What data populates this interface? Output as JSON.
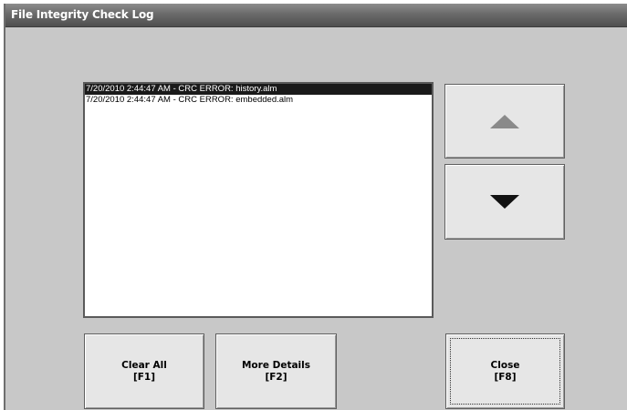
{
  "window": {
    "title": "File Integrity Check Log"
  },
  "log": {
    "entries": [
      {
        "text": "7/20/2010 2:44:47 AM - CRC ERROR: history.alm",
        "selected": true
      },
      {
        "text": "7/20/2010 2:44:47 AM - CRC ERROR: embedded.alm",
        "selected": false
      }
    ]
  },
  "scroll": {
    "up_icon": "triangle-up-icon",
    "down_icon": "triangle-down-icon"
  },
  "buttons": {
    "clear_all": {
      "label": "Clear All",
      "key": "[F1]"
    },
    "more_details": {
      "label": "More Details",
      "key": "[F2]"
    },
    "close": {
      "label": "Close",
      "key": "[F8]"
    }
  },
  "colors": {
    "selection_bg": "#1a1a1a",
    "window_bg": "#c8c8c8",
    "button_bg": "#e6e6e6"
  }
}
